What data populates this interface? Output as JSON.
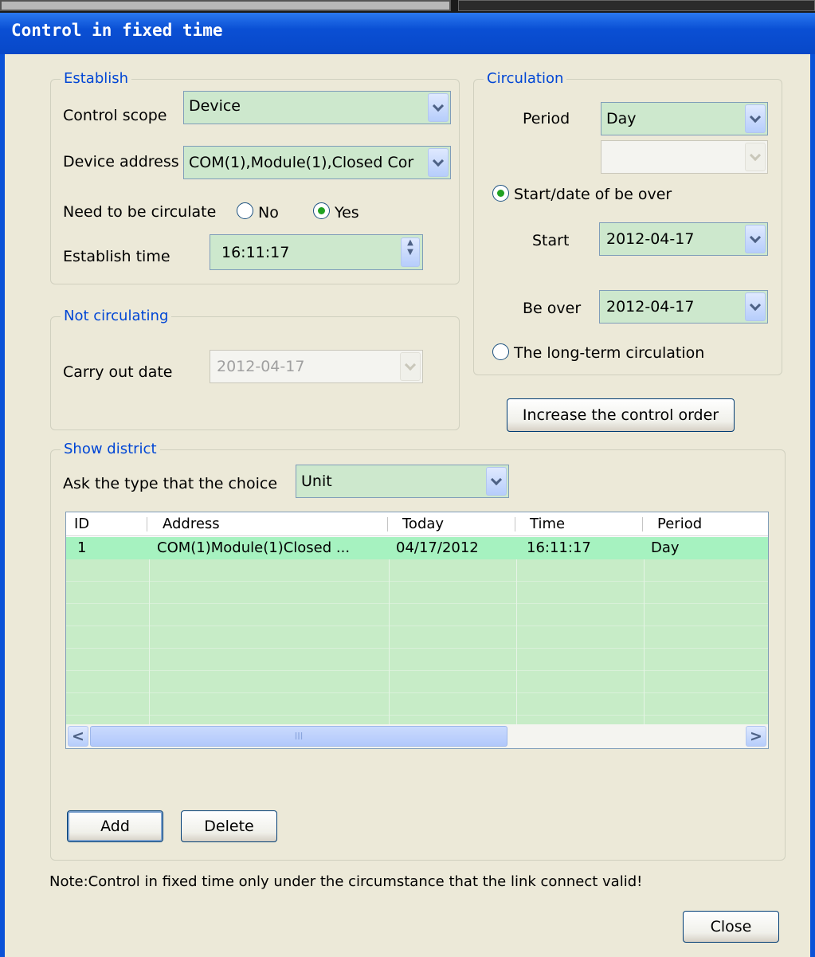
{
  "window": {
    "title": "Control in fixed time"
  },
  "establish": {
    "legend": "Establish",
    "control_scope_label": "Control scope",
    "control_scope_value": "Device",
    "device_address_label": "Device address",
    "device_address_value": "COM(1),Module(1),Closed Cor",
    "circulate_label": "Need to be circulate",
    "radio_no": "No",
    "radio_yes": "Yes",
    "circulate_selected": "Yes",
    "establish_time_label": "Establish time",
    "establish_time_value": "16:11:17"
  },
  "not_circulating": {
    "legend": "Not circulating",
    "carry_out_label": "Carry out date",
    "carry_out_value": "2012-04-17"
  },
  "circulation": {
    "legend": "Circulation",
    "period_label": "Period",
    "period_value": "Day",
    "second_value": "",
    "radio_start_over": "Start/date of be over",
    "start_label": "Start",
    "start_value": "2012-04-17",
    "be_over_label": "Be over",
    "be_over_value": "2012-04-17",
    "radio_long_term": "The long-term circulation",
    "selected": "Start/date of be over"
  },
  "increase_button": "Increase the control order",
  "show_district": {
    "legend": "Show district",
    "ask_label": "Ask the type that the choice",
    "ask_value": "Unit",
    "columns": [
      "ID",
      "Address",
      "Today",
      "Time",
      "Period"
    ],
    "rows": [
      {
        "id": "1",
        "address": "COM(1)Module(1)Closed ...",
        "today": "04/17/2012",
        "time": "16:11:17",
        "period": "Day"
      }
    ],
    "scroll_thumb_grip": "III",
    "add_button": "Add",
    "delete_button": "Delete"
  },
  "note": "Note:Control in fixed time only under the circumstance that the link connect valid!",
  "close_button": "Close",
  "colors": {
    "title_bar": "#0a52d8",
    "client_bg": "#ece9d8",
    "field_bg": "#cde8cd",
    "selected_row": "#a6f2c0",
    "legend_text": "#0046d5"
  }
}
